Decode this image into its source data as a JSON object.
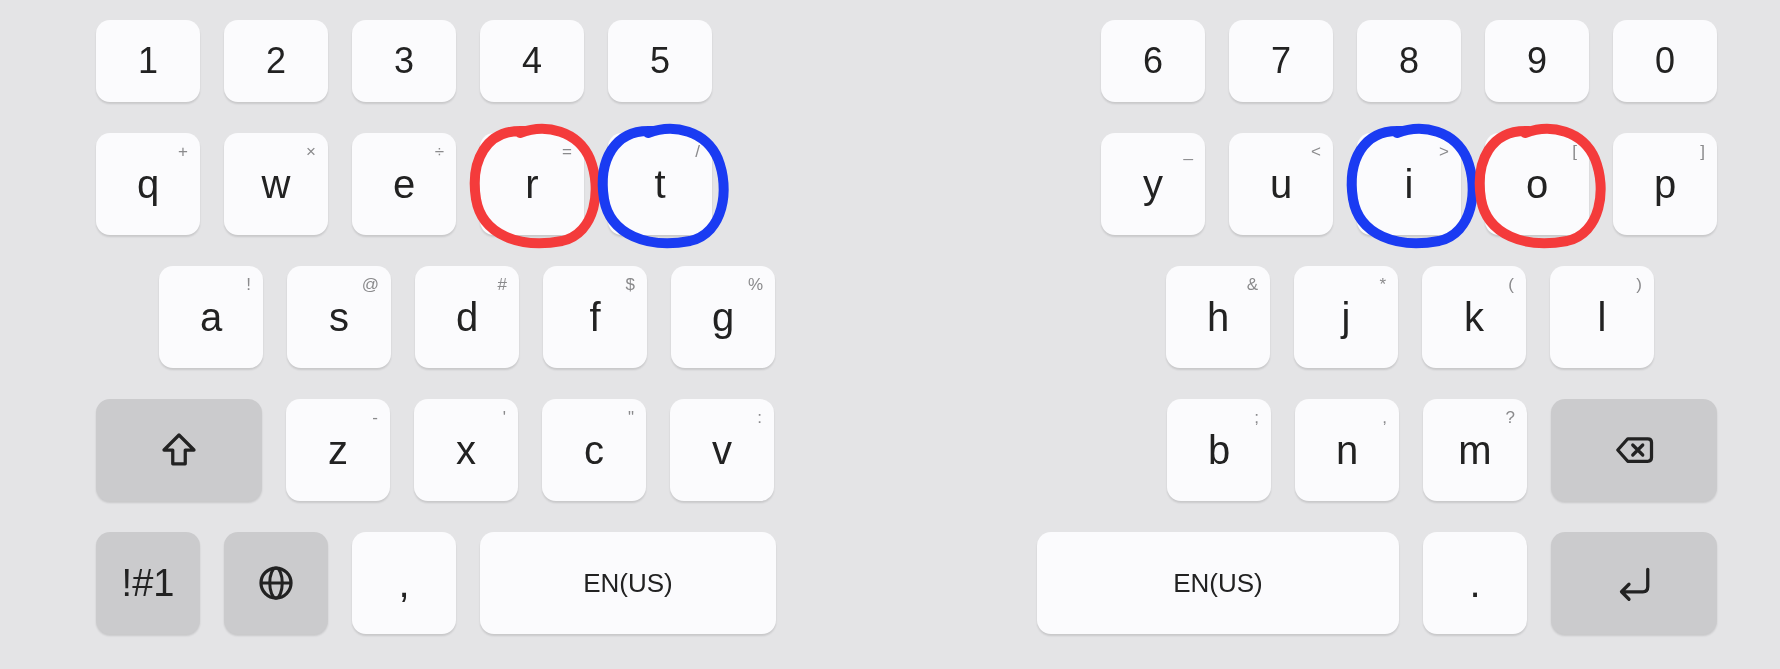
{
  "left": {
    "rows": [
      [
        {
          "kind": "char",
          "label": "1"
        },
        {
          "kind": "char",
          "label": "2"
        },
        {
          "kind": "char",
          "label": "3"
        },
        {
          "kind": "char",
          "label": "4"
        },
        {
          "kind": "char",
          "label": "5"
        }
      ],
      [
        {
          "kind": "char",
          "label": "q",
          "hint": "+"
        },
        {
          "kind": "char",
          "label": "w",
          "hint": "×"
        },
        {
          "kind": "char",
          "label": "e",
          "hint": "÷"
        },
        {
          "kind": "char",
          "label": "r",
          "hint": "=",
          "mark": {
            "color": "#f43b3b"
          }
        },
        {
          "kind": "char",
          "label": "t",
          "hint": "/",
          "mark": {
            "color": "#1a3bf2"
          }
        }
      ],
      [
        {
          "kind": "char",
          "label": "a",
          "hint": "!"
        },
        {
          "kind": "char",
          "label": "s",
          "hint": "@"
        },
        {
          "kind": "char",
          "label": "d",
          "hint": "#"
        },
        {
          "kind": "char",
          "label": "f",
          "hint": "$"
        },
        {
          "kind": "char",
          "label": "g",
          "hint": "%"
        }
      ],
      [
        {
          "kind": "shift"
        },
        {
          "kind": "char",
          "label": "z",
          "hint": "-"
        },
        {
          "kind": "char",
          "label": "x",
          "hint": "'"
        },
        {
          "kind": "char",
          "label": "c",
          "hint": "\""
        },
        {
          "kind": "char",
          "label": "v",
          "hint": ":"
        }
      ],
      [
        {
          "kind": "symbols",
          "label": "!#1"
        },
        {
          "kind": "globe"
        },
        {
          "kind": "char",
          "label": ","
        },
        {
          "kind": "space",
          "label": "EN(US)"
        }
      ]
    ]
  },
  "right": {
    "rows": [
      [
        {
          "kind": "char",
          "label": "6"
        },
        {
          "kind": "char",
          "label": "7"
        },
        {
          "kind": "char",
          "label": "8"
        },
        {
          "kind": "char",
          "label": "9"
        },
        {
          "kind": "char",
          "label": "0"
        }
      ],
      [
        {
          "kind": "char",
          "label": "y",
          "hint": "_"
        },
        {
          "kind": "char",
          "label": "u",
          "hint": "<"
        },
        {
          "kind": "char",
          "label": "i",
          "hint": ">",
          "mark": {
            "color": "#1a3bf2"
          }
        },
        {
          "kind": "char",
          "label": "o",
          "hint": "[",
          "mark": {
            "color": "#f43b3b"
          }
        },
        {
          "kind": "char",
          "label": "p",
          "hint": "]"
        }
      ],
      [
        {
          "kind": "char",
          "label": "h",
          "hint": "&"
        },
        {
          "kind": "char",
          "label": "j",
          "hint": "*"
        },
        {
          "kind": "char",
          "label": "k",
          "hint": "("
        },
        {
          "kind": "char",
          "label": "l",
          "hint": ")"
        }
      ],
      [
        {
          "kind": "char",
          "label": "b",
          "hint": ";"
        },
        {
          "kind": "char",
          "label": "n",
          "hint": ","
        },
        {
          "kind": "char",
          "label": "m",
          "hint": "?"
        },
        {
          "kind": "backspace"
        }
      ],
      [
        {
          "kind": "space",
          "label": "EN(US)"
        },
        {
          "kind": "char",
          "label": "."
        },
        {
          "kind": "enter"
        }
      ]
    ]
  }
}
